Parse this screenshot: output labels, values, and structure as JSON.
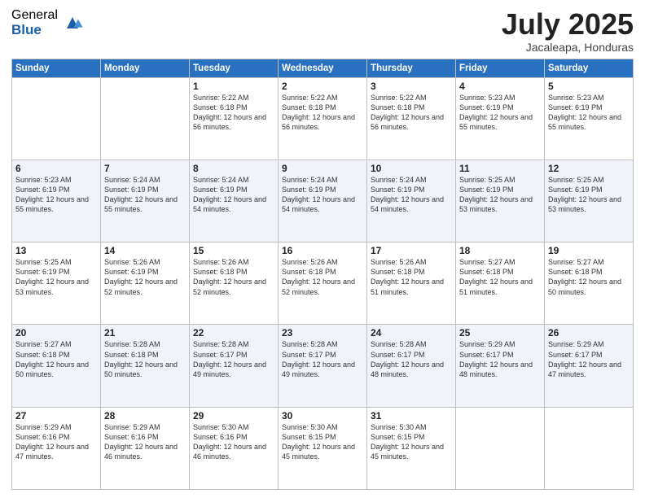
{
  "header": {
    "logo_general": "General",
    "logo_blue": "Blue",
    "title": "July 2025",
    "subtitle": "Jacaleapa, Honduras"
  },
  "days_of_week": [
    "Sunday",
    "Monday",
    "Tuesday",
    "Wednesday",
    "Thursday",
    "Friday",
    "Saturday"
  ],
  "weeks": [
    [
      {
        "day": "",
        "sunrise": "",
        "sunset": "",
        "daylight": ""
      },
      {
        "day": "",
        "sunrise": "",
        "sunset": "",
        "daylight": ""
      },
      {
        "day": "1",
        "sunrise": "Sunrise: 5:22 AM",
        "sunset": "Sunset: 6:18 PM",
        "daylight": "Daylight: 12 hours and 56 minutes."
      },
      {
        "day": "2",
        "sunrise": "Sunrise: 5:22 AM",
        "sunset": "Sunset: 6:18 PM",
        "daylight": "Daylight: 12 hours and 56 minutes."
      },
      {
        "day": "3",
        "sunrise": "Sunrise: 5:22 AM",
        "sunset": "Sunset: 6:18 PM",
        "daylight": "Daylight: 12 hours and 56 minutes."
      },
      {
        "day": "4",
        "sunrise": "Sunrise: 5:23 AM",
        "sunset": "Sunset: 6:19 PM",
        "daylight": "Daylight: 12 hours and 55 minutes."
      },
      {
        "day": "5",
        "sunrise": "Sunrise: 5:23 AM",
        "sunset": "Sunset: 6:19 PM",
        "daylight": "Daylight: 12 hours and 55 minutes."
      }
    ],
    [
      {
        "day": "6",
        "sunrise": "Sunrise: 5:23 AM",
        "sunset": "Sunset: 6:19 PM",
        "daylight": "Daylight: 12 hours and 55 minutes."
      },
      {
        "day": "7",
        "sunrise": "Sunrise: 5:24 AM",
        "sunset": "Sunset: 6:19 PM",
        "daylight": "Daylight: 12 hours and 55 minutes."
      },
      {
        "day": "8",
        "sunrise": "Sunrise: 5:24 AM",
        "sunset": "Sunset: 6:19 PM",
        "daylight": "Daylight: 12 hours and 54 minutes."
      },
      {
        "day": "9",
        "sunrise": "Sunrise: 5:24 AM",
        "sunset": "Sunset: 6:19 PM",
        "daylight": "Daylight: 12 hours and 54 minutes."
      },
      {
        "day": "10",
        "sunrise": "Sunrise: 5:24 AM",
        "sunset": "Sunset: 6:19 PM",
        "daylight": "Daylight: 12 hours and 54 minutes."
      },
      {
        "day": "11",
        "sunrise": "Sunrise: 5:25 AM",
        "sunset": "Sunset: 6:19 PM",
        "daylight": "Daylight: 12 hours and 53 minutes."
      },
      {
        "day": "12",
        "sunrise": "Sunrise: 5:25 AM",
        "sunset": "Sunset: 6:19 PM",
        "daylight": "Daylight: 12 hours and 53 minutes."
      }
    ],
    [
      {
        "day": "13",
        "sunrise": "Sunrise: 5:25 AM",
        "sunset": "Sunset: 6:19 PM",
        "daylight": "Daylight: 12 hours and 53 minutes."
      },
      {
        "day": "14",
        "sunrise": "Sunrise: 5:26 AM",
        "sunset": "Sunset: 6:19 PM",
        "daylight": "Daylight: 12 hours and 52 minutes."
      },
      {
        "day": "15",
        "sunrise": "Sunrise: 5:26 AM",
        "sunset": "Sunset: 6:18 PM",
        "daylight": "Daylight: 12 hours and 52 minutes."
      },
      {
        "day": "16",
        "sunrise": "Sunrise: 5:26 AM",
        "sunset": "Sunset: 6:18 PM",
        "daylight": "Daylight: 12 hours and 52 minutes."
      },
      {
        "day": "17",
        "sunrise": "Sunrise: 5:26 AM",
        "sunset": "Sunset: 6:18 PM",
        "daylight": "Daylight: 12 hours and 51 minutes."
      },
      {
        "day": "18",
        "sunrise": "Sunrise: 5:27 AM",
        "sunset": "Sunset: 6:18 PM",
        "daylight": "Daylight: 12 hours and 51 minutes."
      },
      {
        "day": "19",
        "sunrise": "Sunrise: 5:27 AM",
        "sunset": "Sunset: 6:18 PM",
        "daylight": "Daylight: 12 hours and 50 minutes."
      }
    ],
    [
      {
        "day": "20",
        "sunrise": "Sunrise: 5:27 AM",
        "sunset": "Sunset: 6:18 PM",
        "daylight": "Daylight: 12 hours and 50 minutes."
      },
      {
        "day": "21",
        "sunrise": "Sunrise: 5:28 AM",
        "sunset": "Sunset: 6:18 PM",
        "daylight": "Daylight: 12 hours and 50 minutes."
      },
      {
        "day": "22",
        "sunrise": "Sunrise: 5:28 AM",
        "sunset": "Sunset: 6:17 PM",
        "daylight": "Daylight: 12 hours and 49 minutes."
      },
      {
        "day": "23",
        "sunrise": "Sunrise: 5:28 AM",
        "sunset": "Sunset: 6:17 PM",
        "daylight": "Daylight: 12 hours and 49 minutes."
      },
      {
        "day": "24",
        "sunrise": "Sunrise: 5:28 AM",
        "sunset": "Sunset: 6:17 PM",
        "daylight": "Daylight: 12 hours and 48 minutes."
      },
      {
        "day": "25",
        "sunrise": "Sunrise: 5:29 AM",
        "sunset": "Sunset: 6:17 PM",
        "daylight": "Daylight: 12 hours and 48 minutes."
      },
      {
        "day": "26",
        "sunrise": "Sunrise: 5:29 AM",
        "sunset": "Sunset: 6:17 PM",
        "daylight": "Daylight: 12 hours and 47 minutes."
      }
    ],
    [
      {
        "day": "27",
        "sunrise": "Sunrise: 5:29 AM",
        "sunset": "Sunset: 6:16 PM",
        "daylight": "Daylight: 12 hours and 47 minutes."
      },
      {
        "day": "28",
        "sunrise": "Sunrise: 5:29 AM",
        "sunset": "Sunset: 6:16 PM",
        "daylight": "Daylight: 12 hours and 46 minutes."
      },
      {
        "day": "29",
        "sunrise": "Sunrise: 5:30 AM",
        "sunset": "Sunset: 6:16 PM",
        "daylight": "Daylight: 12 hours and 46 minutes."
      },
      {
        "day": "30",
        "sunrise": "Sunrise: 5:30 AM",
        "sunset": "Sunset: 6:15 PM",
        "daylight": "Daylight: 12 hours and 45 minutes."
      },
      {
        "day": "31",
        "sunrise": "Sunrise: 5:30 AM",
        "sunset": "Sunset: 6:15 PM",
        "daylight": "Daylight: 12 hours and 45 minutes."
      },
      {
        "day": "",
        "sunrise": "",
        "sunset": "",
        "daylight": ""
      },
      {
        "day": "",
        "sunrise": "",
        "sunset": "",
        "daylight": ""
      }
    ]
  ]
}
